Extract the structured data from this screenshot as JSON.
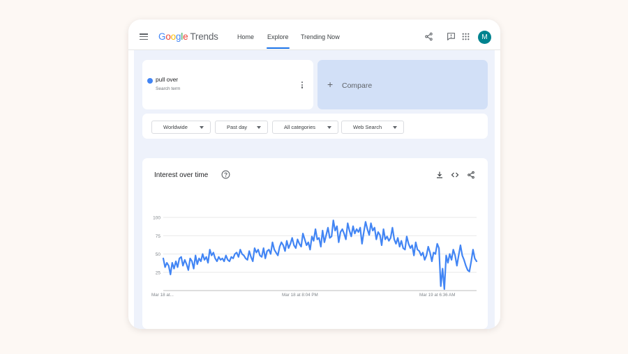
{
  "header": {
    "logo_google": "Google",
    "logo_trends": "Trends",
    "nav": [
      {
        "label": "Home"
      },
      {
        "label": "Explore"
      },
      {
        "label": "Trending Now"
      }
    ],
    "avatar_initial": "M",
    "icons": [
      "menu-icon",
      "share-icon",
      "feedback-icon",
      "apps-grid-icon"
    ]
  },
  "search": {
    "term": "pull over",
    "term_type": "Search term",
    "term_color": "#4285f4",
    "compare_label": "Compare"
  },
  "filters": [
    {
      "label": "Worldwide"
    },
    {
      "label": "Past day"
    },
    {
      "label": "All categories"
    },
    {
      "label": "Web Search"
    }
  ],
  "chart_card": {
    "title": "Interest over time",
    "icons": [
      "help-icon",
      "download-icon",
      "embed-code-icon",
      "share-icon"
    ]
  },
  "chart_data": {
    "type": "line",
    "title": "",
    "xlabel": "",
    "ylabel": "",
    "ylim": [
      0,
      100
    ],
    "yticks": [
      25,
      50,
      75,
      100
    ],
    "x_tick_labels": [
      "Mar 18 at...",
      "Mar 18 at 8:04 PM",
      "Mar 19 at 6:36 AM"
    ],
    "grid": true,
    "series": [
      {
        "color": "#4285f4",
        "values": [
          44,
          32,
          38,
          34,
          22,
          38,
          30,
          40,
          32,
          44,
          46,
          34,
          42,
          36,
          28,
          44,
          40,
          30,
          48,
          36,
          44,
          40,
          50,
          42,
          46,
          38,
          56,
          48,
          52,
          44,
          40,
          46,
          42,
          44,
          40,
          48,
          42,
          40,
          46,
          44,
          50,
          52,
          46,
          56,
          50,
          48,
          44,
          42,
          54,
          46,
          40,
          58,
          52,
          56,
          48,
          46,
          58,
          44,
          54,
          56,
          50,
          66,
          56,
          52,
          48,
          60,
          66,
          62,
          54,
          68,
          58,
          64,
          72,
          62,
          58,
          70,
          64,
          60,
          78,
          70,
          62,
          66,
          56,
          74,
          68,
          84,
          70,
          72,
          60,
          82,
          66,
          76,
          86,
          72,
          74,
          96,
          82,
          88,
          66,
          80,
          84,
          78,
          70,
          92,
          82,
          74,
          88,
          78,
          84,
          80,
          86,
          64,
          80,
          94,
          84,
          76,
          92,
          82,
          86,
          70,
          80,
          76,
          62,
          84,
          70,
          74,
          68,
          72,
          86,
          70,
          64,
          72,
          60,
          68,
          58,
          56,
          74,
          64,
          58,
          62,
          48,
          66,
          56,
          54,
          48,
          52,
          42,
          48,
          60,
          52,
          40,
          52,
          50,
          64,
          58,
          6,
          30,
          2,
          48,
          38,
          50,
          42,
          56,
          48,
          34,
          48,
          62,
          48,
          42,
          34,
          28,
          26,
          40,
          56,
          44,
          40
        ]
      }
    ]
  }
}
